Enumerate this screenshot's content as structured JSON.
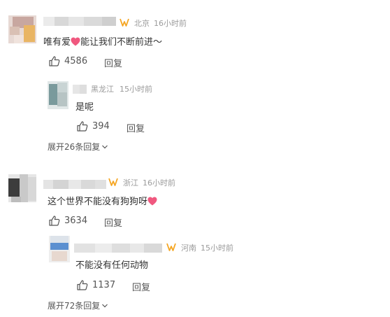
{
  "comments": [
    {
      "location": "北京",
      "time": "16小时前",
      "text": "唯有爱",
      "text_after_emoji": "能让我们不断前进～",
      "likes": "4586",
      "reply_label": "回复",
      "reply": {
        "location": "黑龙江",
        "time": "15小时前",
        "text": "是呢",
        "likes": "394",
        "reply_label": "回复"
      },
      "expand_label": "展开26条回复"
    },
    {
      "location": "浙江",
      "time": "16小时前",
      "text": "这个世界不能没有狗狗呀",
      "likes": "3634",
      "reply_label": "回复",
      "reply": {
        "location": "河南",
        "time": "15小时前",
        "text": "不能没有任何动物",
        "likes": "1137",
        "reply_label": "回复"
      },
      "expand_label": "展开72条回复"
    }
  ],
  "icons": {
    "like": "thumbs-up-icon",
    "verified": "weibo-vip-badge-icon",
    "emoji": "heart-emoji-icon",
    "expand": "chevron-down-icon"
  },
  "colors": {
    "badge": "#f5a623",
    "heart": "#f0587f",
    "meta": "#9a9a9a"
  }
}
